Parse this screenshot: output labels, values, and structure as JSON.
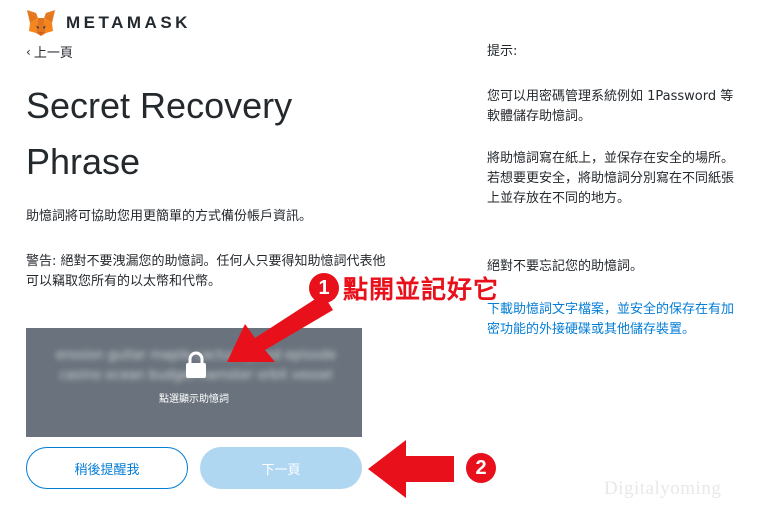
{
  "header": {
    "brand": "METAMASK",
    "back_label": "上一頁"
  },
  "main": {
    "title": "Secret Recovery Phrase",
    "description": "助憶詞將可協助您用更簡單的方式備份帳戶資訊。",
    "warning": "警告: 絕對不要洩漏您的助憶詞。任何人只要得知助憶詞代表他可以竊取您所有的以太幣和代幣。",
    "blurred_phrase": "erosion guitar maple cactus spend episode casino ocean budget hamster orbit vessel",
    "reveal_label": "點選顯示助憶詞"
  },
  "buttons": {
    "remind_later": "稍後提醒我",
    "next": "下一頁"
  },
  "tips": {
    "heading": "提示:",
    "tip1": "您可以用密碼管理系統例如 1Password 等軟體儲存助憶詞。",
    "tip2": "將助憶詞寫在紙上，並保存在安全的場所。若想要更安全，將助憶詞分別寫在不同紙張上並存放在不同的地方。",
    "tip3": "絕對不要忘記您的助憶詞。",
    "download_link": "下載助憶詞文字檔案，並安全的保存在有加密功能的外接硬碟或其他儲存裝置。"
  },
  "annotations": {
    "step1_number": "1",
    "step1_text": "點開並記好它",
    "step2_number": "2"
  },
  "watermark": "Digitalyoming",
  "colors": {
    "accent": "#037dd6",
    "annotation_red": "#e8101b",
    "reveal_box": "#6a737d",
    "next_disabled": "#b0d7f2"
  }
}
